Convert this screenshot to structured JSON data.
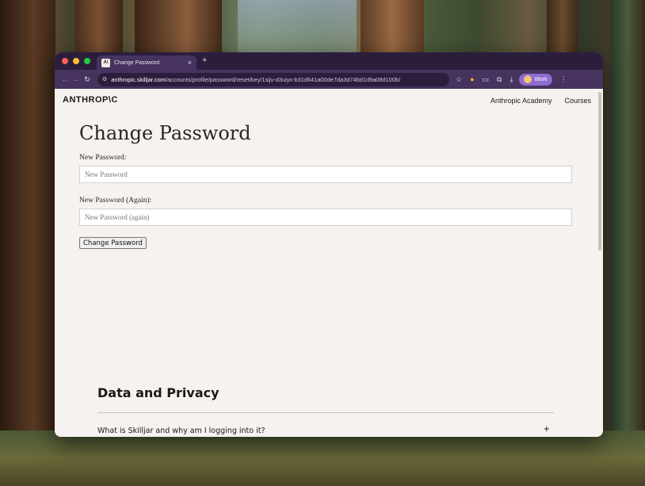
{
  "browser": {
    "tab_title": "Change Password",
    "tab_favicon": "A\\",
    "tab_close": "×",
    "new_tab": "+",
    "url_host": "anthropic.skilljar.com",
    "url_path": "/accounts/profile/password/reset/key/1sijv-d3uiyx-b31d641a00de7da3d74bd1d9a08d100b/",
    "profile_label": "Work",
    "icons": [
      "back-arrow-icon",
      "forward-arrow-icon",
      "reload-icon",
      "site-info-icon",
      "star-icon",
      "extension-icon",
      "cast-icon",
      "puzzle-icon",
      "download-icon",
      "kebab-menu-icon"
    ]
  },
  "site": {
    "logo": "ANTHROP\\C",
    "nav": [
      "Anthropic Academy",
      "Courses"
    ]
  },
  "form": {
    "title": "Change Password",
    "new_password_label": "New Password:",
    "new_password_placeholder": "New Password",
    "new_password_again_label": "New Password (Again):",
    "new_password_again_placeholder": "New Password (again)",
    "submit_label": "Change Password"
  },
  "footer": {
    "section_title": "Data and Privacy",
    "faq_question": "What is Skilljar and why am I logging into it?",
    "faq_toggle": "+"
  }
}
